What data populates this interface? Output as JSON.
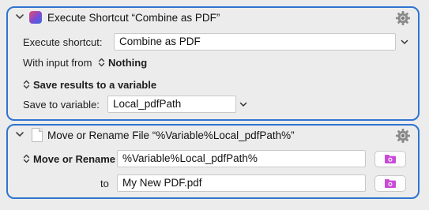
{
  "action1": {
    "title": "Execute Shortcut “Combine as PDF”",
    "shortcut_label": "Execute shortcut:",
    "shortcut_value": "Combine as PDF",
    "input_label": "With input from",
    "input_value": "Nothing",
    "save_results_label": "Save results to a variable",
    "save_to_label": "Save to variable:",
    "save_to_value": "Local_pdfPath"
  },
  "action2": {
    "title": "Move or Rename File “%Variable%Local_pdfPath%”",
    "operation_value": "Move or Rename",
    "source_value": "%Variable%Local_pdfPath%",
    "to_label": "to",
    "destination_value": "My New PDF.pdf"
  },
  "colors": {
    "selection_border": "#2f74d0",
    "folder_icon": "#c84bd6"
  },
  "icons": [
    "chevron-down-icon",
    "shortcuts-app-icon",
    "gear-icon",
    "updown-chevron-icon",
    "dropdown-chevron-icon",
    "file-icon",
    "folder-icon"
  ]
}
